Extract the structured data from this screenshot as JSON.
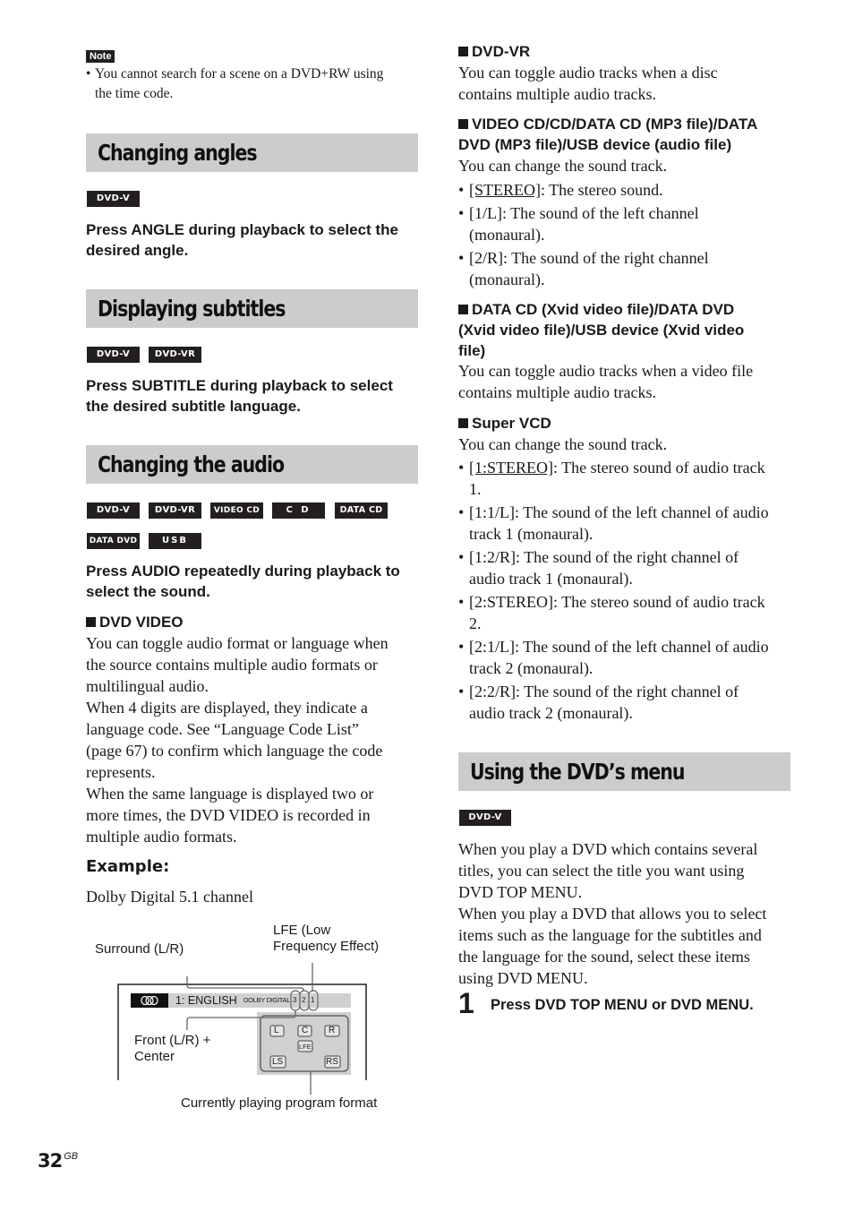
{
  "note": {
    "label": "Note",
    "bullet": "•",
    "text_line1": "You cannot search for a scene on a DVD+RW using",
    "text_line2": "the time code."
  },
  "left": {
    "angles": {
      "title": "Changing angles",
      "badges": [
        "DVD-V"
      ],
      "instruction_line1": "Press ANGLE during playback to select the",
      "instruction_line2": "desired angle."
    },
    "subtitles": {
      "title": "Displaying subtitles",
      "badges": [
        "DVD-V",
        "DVD-VR"
      ],
      "instruction_line1": "Press SUBTITLE during playback to select",
      "instruction_line2": "the desired subtitle language."
    },
    "audio": {
      "title": "Changing the audio",
      "badges": [
        "DVD-V",
        "DVD-VR",
        "VIDEO CD",
        "C D",
        "DATA CD",
        "DATA DVD",
        "USB"
      ],
      "instruction_line1": "Press AUDIO repeatedly during playback to",
      "instruction_line2": "select the sound.",
      "dvd_video": {
        "heading": "DVD VIDEO",
        "lines": [
          "You can toggle audio format or language when",
          "the source contains multiple audio formats or",
          "multilingual audio.",
          "When 4 digits are displayed, they indicate a",
          "language code. See “Language Code List”",
          "(page 67) to confirm which language the code",
          "represents.",
          "When the same language is displayed two or",
          "more times, the DVD VIDEO is recorded in",
          "multiple audio formats."
        ]
      },
      "example": {
        "heading": "Example:",
        "caption": "Dolby Digital 5.1 channel",
        "diagram": {
          "label_surround": "Surround (L/R)",
          "label_lfe_line1": "LFE (Low",
          "label_lfe_line2": "Frequency Effect)",
          "label_front_line1": "Front (L/R) +",
          "label_front_line2": "Center",
          "label_format": "Currently playing program format",
          "osd_track": "1: ENGLISH",
          "osd_format": "DOLBY DIGITAL",
          "osd_digits": [
            "3",
            "2",
            "1"
          ],
          "speakers": {
            "l": "L",
            "c": "C",
            "r": "R",
            "lfe": "LFE",
            "ls": "LS",
            "rs": "RS"
          }
        }
      }
    }
  },
  "right": {
    "dvd_vr": {
      "heading": "DVD-VR",
      "lines": [
        "You can toggle audio tracks when a disc",
        "contains multiple audio tracks."
      ]
    },
    "vcd": {
      "heading_line1": "VIDEO CD/CD/DATA CD (MP3 file)/DATA",
      "heading_line2": "DVD (MP3 file)/USB device (audio file)",
      "intro": "You can change the sound track.",
      "items": [
        {
          "key": "[STEREO]",
          "underline": true,
          "text": ": The stereo sound.",
          "cont": ""
        },
        {
          "key": "[1/L]",
          "underline": false,
          "text": ": The sound of the left channel",
          "cont": "(monaural)."
        },
        {
          "key": "[2/R]",
          "underline": false,
          "text": ": The sound of the right channel",
          "cont": "(monaural)."
        }
      ]
    },
    "xvid": {
      "heading_line1": "DATA CD (Xvid video file)/DATA DVD",
      "heading_line2": "(Xvid video file)/USB device (Xvid video",
      "heading_line3": "file)",
      "lines": [
        "You can toggle audio tracks when a video file",
        "contains multiple audio tracks."
      ]
    },
    "svcd": {
      "heading": "Super VCD",
      "intro": "You can change the sound track.",
      "items": [
        {
          "key": "[1:STEREO]",
          "underline": true,
          "text": ": The stereo sound of audio track",
          "cont": "1."
        },
        {
          "key": "[1:1/L]",
          "underline": false,
          "text": ": The sound of the left channel of audio",
          "cont": "track 1 (monaural)."
        },
        {
          "key": "[1:2/R]",
          "underline": false,
          "text": ": The sound of the right channel of",
          "cont": "audio track 1 (monaural)."
        },
        {
          "key": "[2:STEREO]",
          "underline": false,
          "text": ": The stereo sound of audio track",
          "cont": "2."
        },
        {
          "key": "[2:1/L]",
          "underline": false,
          "text": ": The sound of the left channel of audio",
          "cont": "track 2 (monaural)."
        },
        {
          "key": "[2:2/R]",
          "underline": false,
          "text": ": The sound of the right channel of",
          "cont": "audio track 2 (monaural)."
        }
      ]
    },
    "menu": {
      "title": "Using the DVD’s menu",
      "badges": [
        "DVD-V"
      ],
      "lines": [
        "When you play a DVD which contains several",
        "titles, you can select the title you want using",
        "DVD TOP MENU.",
        "When you play a DVD that allows you to select",
        "items such as the language for the subtitles and",
        "the language for the sound, select these items",
        "using DVD MENU."
      ],
      "step_number": "1",
      "step_text": "Press DVD TOP MENU or DVD MENU."
    }
  },
  "footer": {
    "page_number": "32",
    "region": "GB"
  }
}
